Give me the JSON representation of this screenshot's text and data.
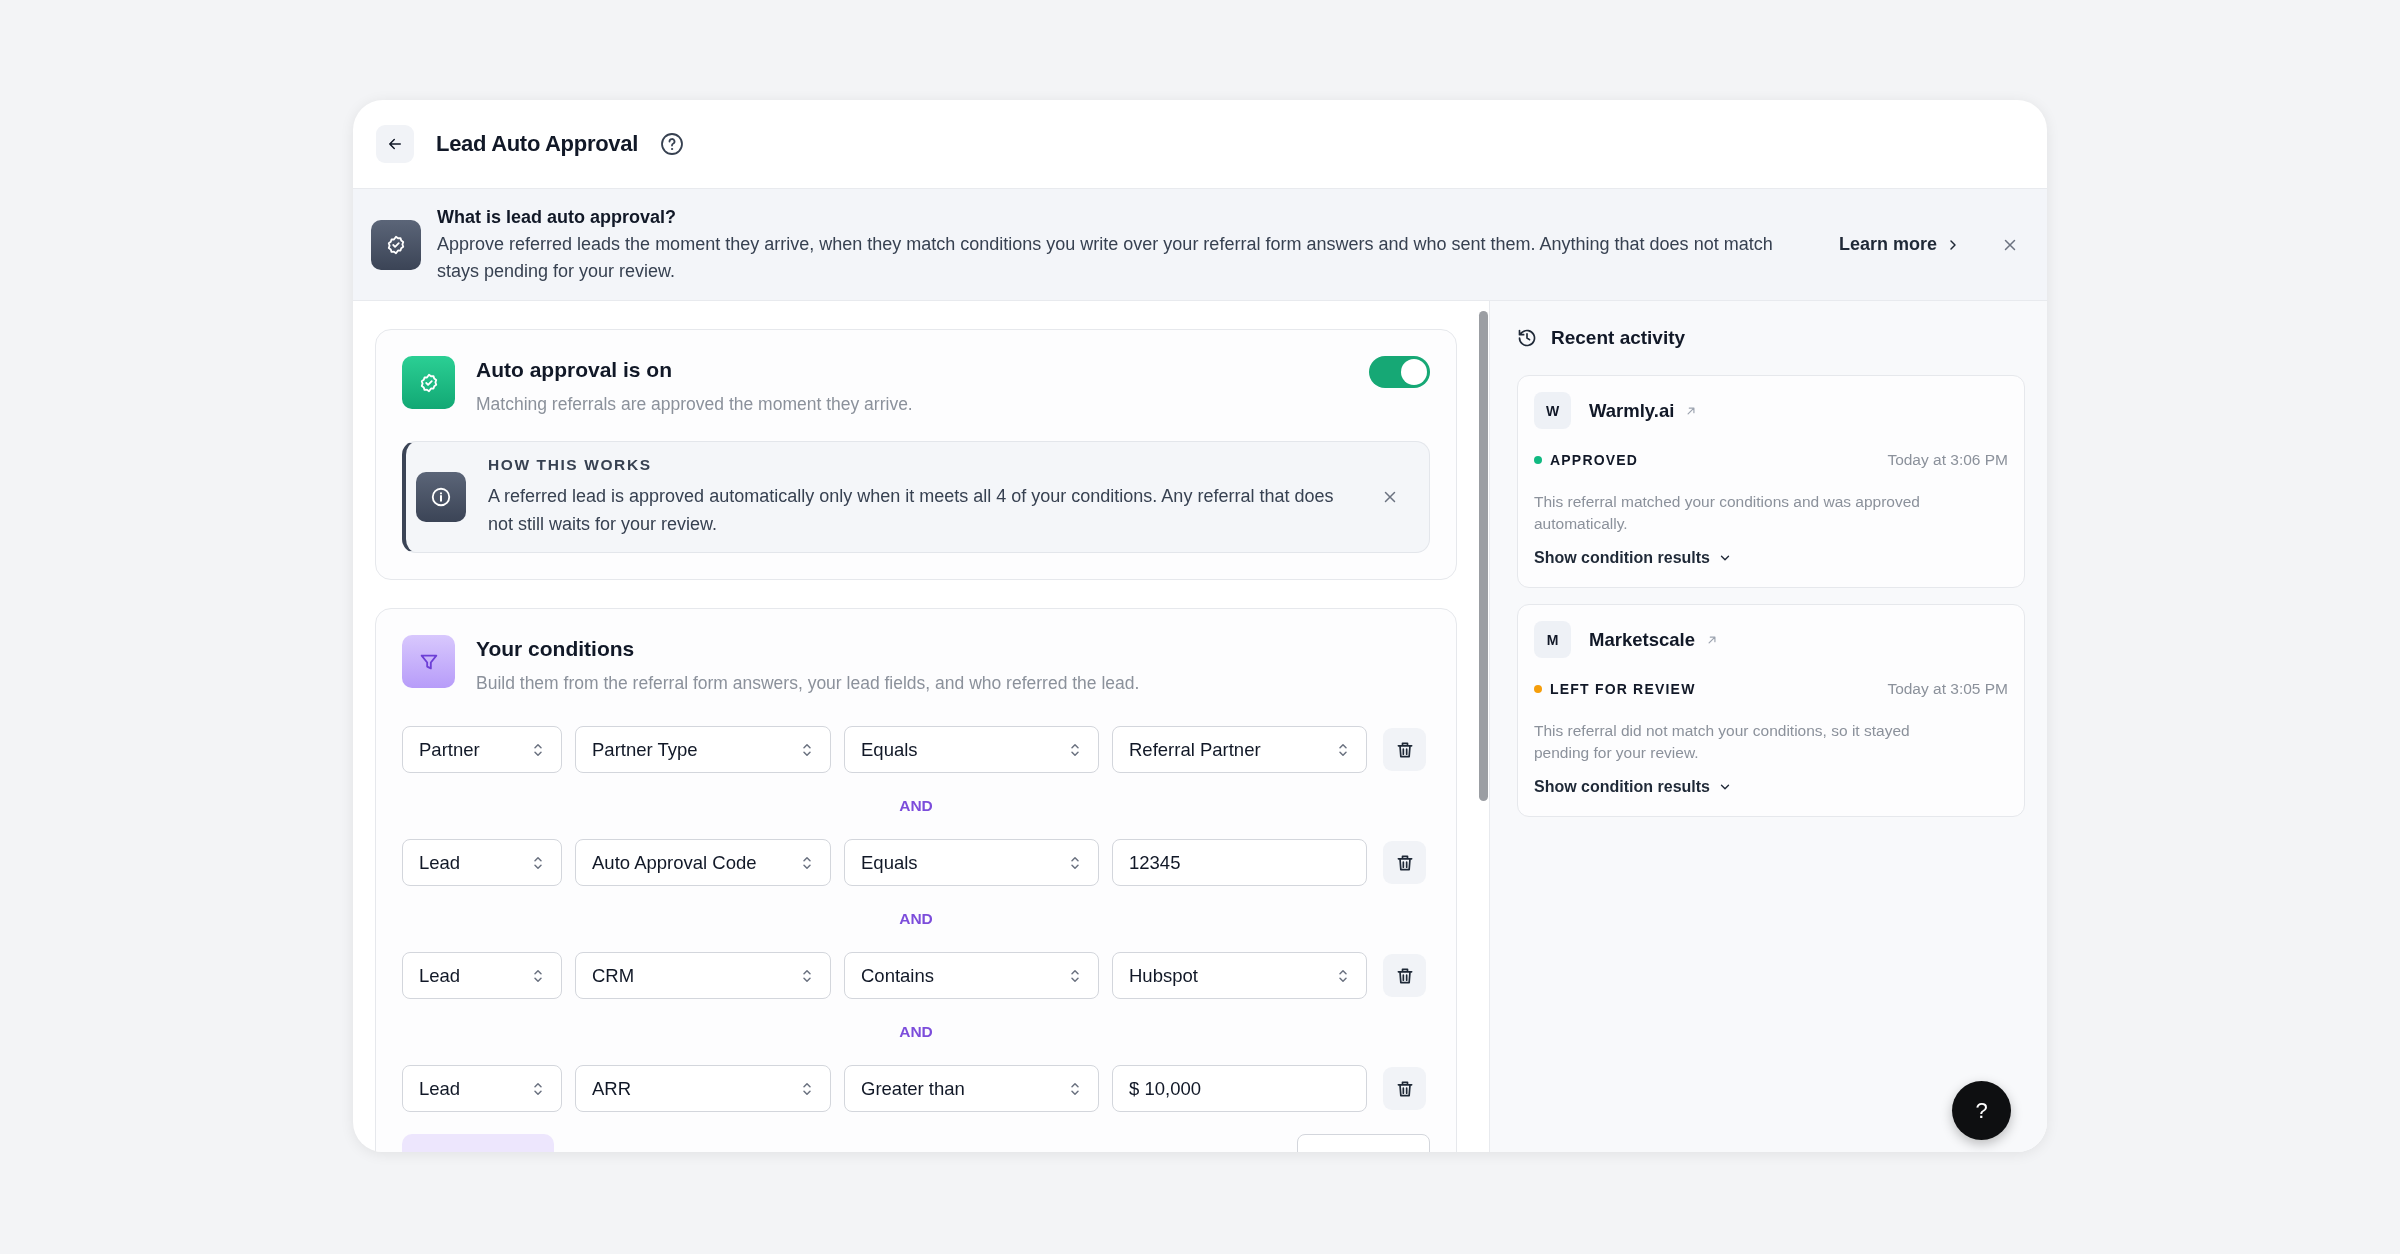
{
  "window": {
    "title": "Lead Auto Approval"
  },
  "banner": {
    "title": "What is lead auto approval?",
    "text": "Approve referred leads the moment they arrive, when they match conditions you write over your referral form answers and who sent them. Anything that does not match stays pending for your review.",
    "link": "Learn more"
  },
  "auto_approval": {
    "title": "Auto approval is on",
    "subtitle": "Matching referrals are approved the moment they arrive.",
    "on": true,
    "how_it_works": {
      "title": "HOW THIS WORKS",
      "text": "A referred lead is approved automatically only when it meets all 4 of your conditions. Any referral that does not still waits for your review."
    }
  },
  "conditions": {
    "title": "Your conditions",
    "subtitle": "Build them from the referral form answers, your lead fields, and who referred the lead.",
    "rows": [
      {
        "source": "Partner",
        "field": "Partner Type",
        "operator": "Equals",
        "value": "Referral Partner",
        "kind": "dropdown"
      },
      {
        "connector": "AND",
        "source": "Lead",
        "field": "Auto Approval Code",
        "operator": "Equals",
        "value": "12345",
        "kind": "text"
      },
      {
        "connector": "AND",
        "source": "Lead",
        "field": "CRM",
        "operator": "Contains",
        "value": "Hubspot",
        "kind": "dropdown"
      },
      {
        "connector": "AND",
        "source": "Lead",
        "field": "ARR",
        "operator": "Greater than",
        "value": "$ 10,000",
        "kind": "text"
      }
    ]
  },
  "recent_activity": {
    "title": "Recent activity",
    "items": [
      {
        "initial": "W",
        "name": "Warmly.ai",
        "status": "APPROVED",
        "color": "#10b981",
        "time": "Today at 3:06 PM",
        "description": "This referral matched your conditions and was approved automatically.",
        "toggle": "Show condition results"
      },
      {
        "initial": "M",
        "name": "Marketscale",
        "status": "LEFT FOR REVIEW",
        "color": "#f59e0b",
        "time": "Today at 3:05 PM",
        "description": "This referral did not match your conditions, so it stayed pending for your review.",
        "toggle": "Show condition results"
      }
    ]
  },
  "help_button": "?"
}
